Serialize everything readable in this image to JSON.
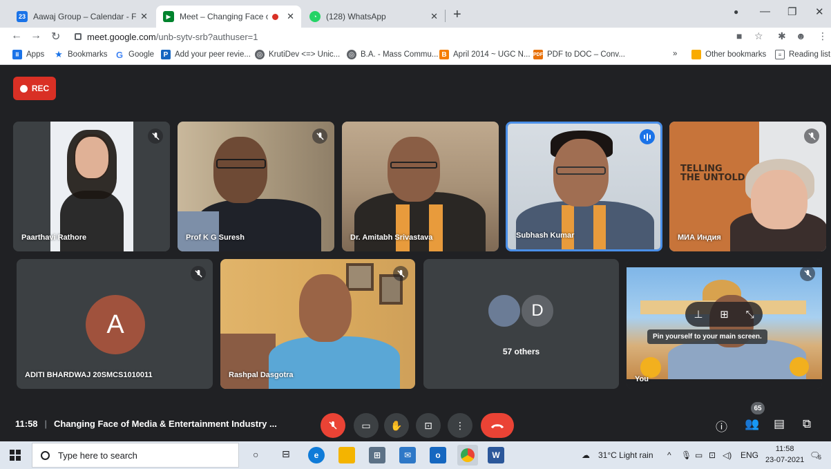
{
  "browser": {
    "tabs": [
      {
        "title": "Aawaj Group – Calendar - Friday",
        "favicon": "calendar-icon",
        "color": "#1a73e8",
        "active": false,
        "fav_text": "23"
      },
      {
        "title": "Meet – Changing Face of Me",
        "favicon": "meet-icon",
        "color": "#00832d",
        "active": true,
        "recording": true
      },
      {
        "title": "(128) WhatsApp",
        "favicon": "whatsapp-icon",
        "color": "#25d366",
        "active": false
      }
    ],
    "url_host": "meet.google.com",
    "url_path": "/unb-sytv-srb?authuser=1",
    "bookmarks": [
      {
        "label": "Apps",
        "icon": "apps-grid-icon",
        "color": "#1a73e8"
      },
      {
        "label": "Bookmarks",
        "icon": "star-icon",
        "color": "#1a73e8"
      },
      {
        "label": "Google",
        "icon": "google-icon",
        "color": "#4285f4"
      },
      {
        "label": "Add your peer revie...",
        "icon": "p-icon",
        "color": "#1565c0"
      },
      {
        "label": "KrutiDev <=> Unic...",
        "icon": "globe-icon",
        "color": "#5f6368"
      },
      {
        "label": "B.A. - Mass Commu...",
        "icon": "globe-icon",
        "color": "#5f6368"
      },
      {
        "label": "April 2014 ~ UGC N...",
        "icon": "blogger-icon",
        "color": "#f57d00"
      },
      {
        "label": "PDF to DOC – Conv...",
        "icon": "pdf-icon",
        "color": "#e8710a"
      }
    ],
    "overflow": "»",
    "other_bookmarks": "Other bookmarks",
    "reading_list": "Reading list"
  },
  "meet": {
    "rec_label": "REC",
    "participants": [
      {
        "name": "Paarthavi Rathore",
        "muted": true
      },
      {
        "name": "Prof K G Suresh",
        "muted": true
      },
      {
        "name": "Dr. Amitabh Srivastava",
        "muted": false
      },
      {
        "name": "Subhash Kumar",
        "muted": false,
        "speaking": true
      },
      {
        "name": "МИА Индия",
        "muted": true
      },
      {
        "name": "ADITI BHARDWAJ 20SMCS1010011",
        "muted": true,
        "avatar_letter": "A"
      },
      {
        "name": "Rashpal Dasgotra",
        "muted": true
      },
      {
        "name": "You",
        "muted": true
      }
    ],
    "others": {
      "label": "57 others",
      "avatar_letter": "D"
    },
    "pin_tooltip": "Pin yourself to your main screen.",
    "time": "11:58",
    "meeting_title": "Changing Face of Media & Entertainment Industry ...",
    "participant_count": "65"
  },
  "taskbar": {
    "search_placeholder": "Type here to search",
    "weather": "31°C  Light rain",
    "lang": "ENG",
    "time": "11:58",
    "date": "23-07-2021",
    "notif_count": "6"
  },
  "colors": {
    "meet_bg": "#202124",
    "tile_bg": "#3c4043",
    "red": "#ea4335",
    "speaking_blue": "#1a73e8"
  }
}
